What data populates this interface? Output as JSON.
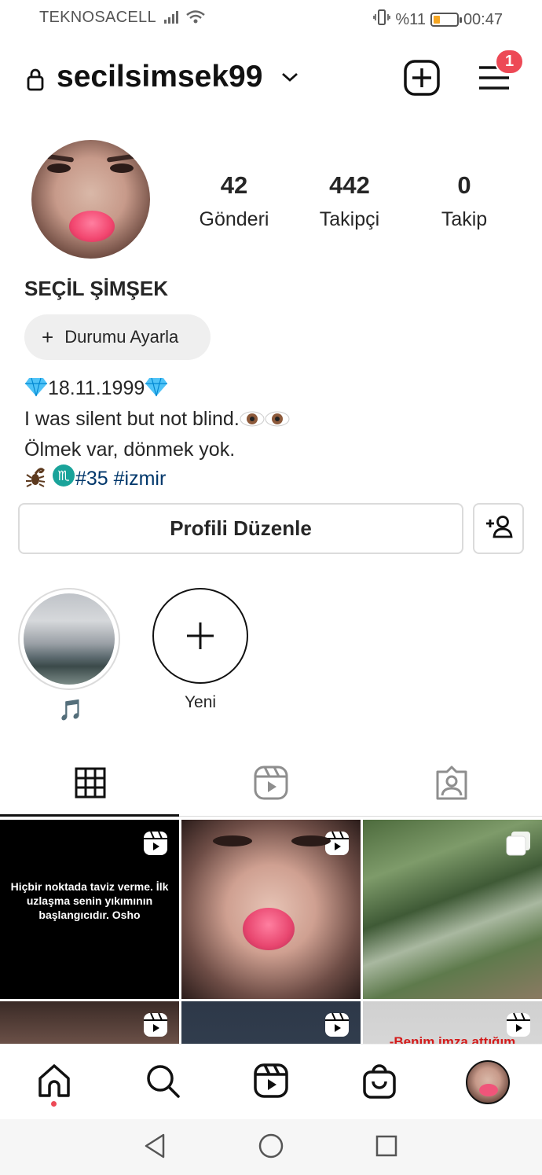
{
  "status_bar": {
    "carrier": "TEKNOSACELL",
    "battery_text": "%11",
    "battery_level": 0.11,
    "time": "00:47"
  },
  "header": {
    "username": "secilsimsek99",
    "menu_badge": "1"
  },
  "profile": {
    "stats": [
      {
        "value": "42",
        "label": "Gönderi"
      },
      {
        "value": "442",
        "label": "Takipçi"
      },
      {
        "value": "0",
        "label": "Takip"
      }
    ],
    "full_name": "SEÇİL ŞİMŞEK",
    "status_button": "Durumu Ayarla",
    "bio": {
      "line1": "18.11.1999",
      "line2": "I was silent but not blind.",
      "line3": "Ölmek var, dönmek yok.",
      "hashtag1": "#35",
      "hashtag2": "#izmir"
    },
    "edit_button": "Profili Düzenle"
  },
  "highlights": [
    {
      "label": "🎵"
    },
    {
      "label": "Yeni"
    }
  ],
  "grid": {
    "quote_text": "Hiçbir noktada taviz verme. İlk uzlaşma senin yıkımının başlangıcıdır. Osho",
    "partial_text": "-Benim imza attığım"
  },
  "colors": {
    "badge": "#ed4956",
    "hashtag": "#00376b",
    "battery": "#f5a623"
  }
}
